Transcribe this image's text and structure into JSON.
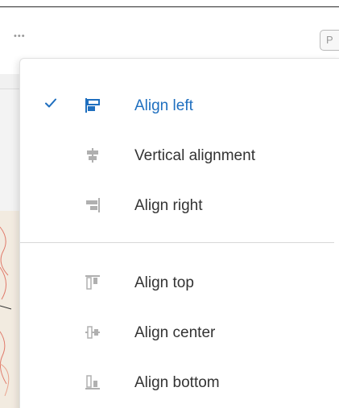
{
  "toolbar": {
    "more_label": "•••",
    "pill_label": "P"
  },
  "menu": {
    "horizontal_items": [
      {
        "label": "Align left",
        "icon": "align-left-icon",
        "selected": true
      },
      {
        "label": "Vertical alignment",
        "icon": "align-vertical-center-icon",
        "selected": false
      },
      {
        "label": "Align right",
        "icon": "align-right-icon",
        "selected": false
      }
    ],
    "vertical_items": [
      {
        "label": "Align top",
        "icon": "align-top-icon",
        "selected": false
      },
      {
        "label": "Align center",
        "icon": "align-middle-icon",
        "selected": false
      },
      {
        "label": "Align bottom",
        "icon": "align-bottom-icon",
        "selected": false
      }
    ]
  },
  "colors": {
    "accent": "#1f6fbf",
    "text": "#333333",
    "icon_muted": "#a8a8a8"
  }
}
